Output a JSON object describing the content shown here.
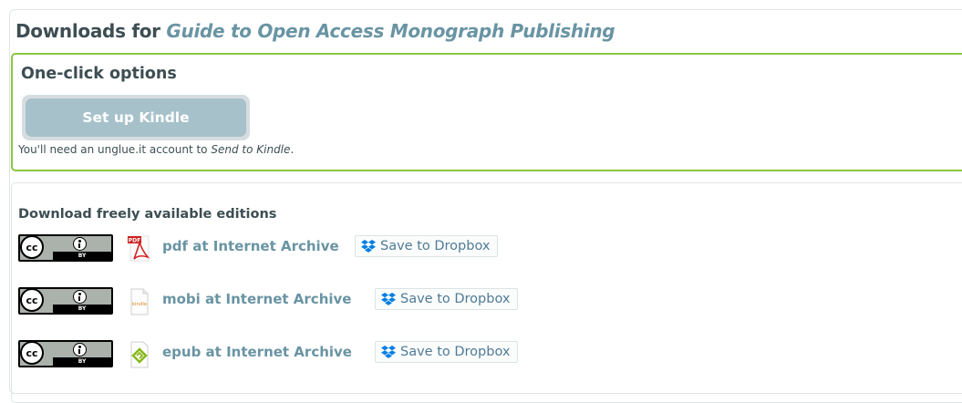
{
  "header": {
    "prefix": "Downloads for",
    "book_title": "Guide to Open Access Monograph Publishing"
  },
  "one_click": {
    "heading": "One-click options",
    "kindle_button": "Set up Kindle",
    "note_prefix": "You'll need an unglue.it account to",
    "note_emph": "Send to Kindle",
    "note_suffix": "."
  },
  "editions": {
    "heading": "Download freely available editions",
    "license_badge": {
      "left": "cc",
      "strip": "BY"
    },
    "items": [
      {
        "format_icon": "pdf-icon",
        "link": "pdf at Internet Archive",
        "dropbox": "Save to Dropbox"
      },
      {
        "format_icon": "kindle-file-icon",
        "link": "mobi at Internet Archive",
        "dropbox": "Save to Dropbox"
      },
      {
        "format_icon": "epub-icon",
        "link": "epub at Internet Archive",
        "dropbox": "Save to Dropbox"
      }
    ]
  },
  "colors": {
    "text": "#3d4e53",
    "accent": "#6994a3",
    "green_border": "#8dc63f",
    "kindle_button": "#a7c1ca",
    "dropbox_blue": "#007ee5"
  }
}
